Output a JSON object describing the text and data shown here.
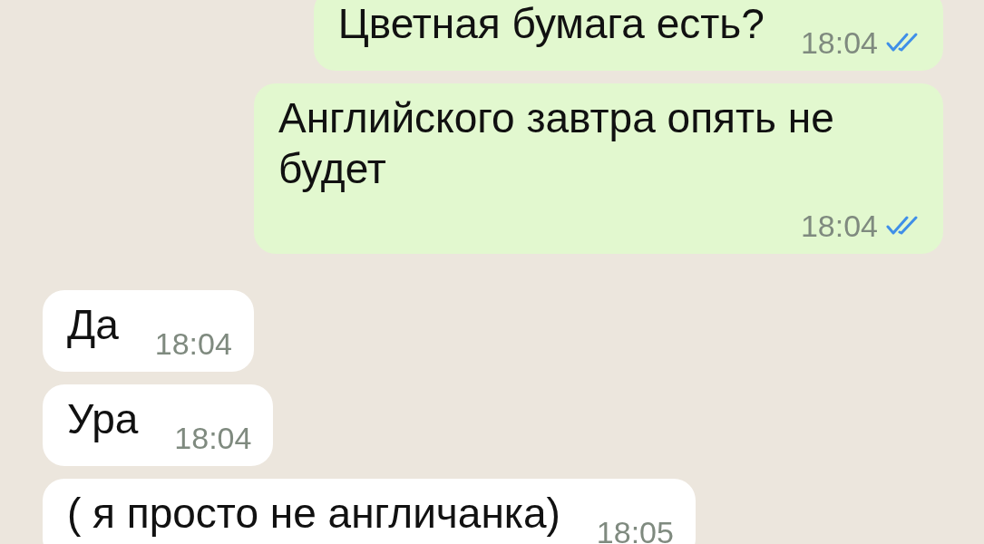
{
  "messages": [
    {
      "outgoing": true,
      "text": "Цветная бумага есть?",
      "time": "18:04",
      "read": true
    },
    {
      "outgoing": true,
      "text": "Английского завтра опять не будет",
      "time": "18:04",
      "read": true
    },
    {
      "outgoing": false,
      "text": "Да",
      "time": "18:04"
    },
    {
      "outgoing": false,
      "text": "Ура",
      "time": "18:04"
    },
    {
      "outgoing": false,
      "text": "( я просто не англичанка)",
      "time": "18:05"
    }
  ]
}
